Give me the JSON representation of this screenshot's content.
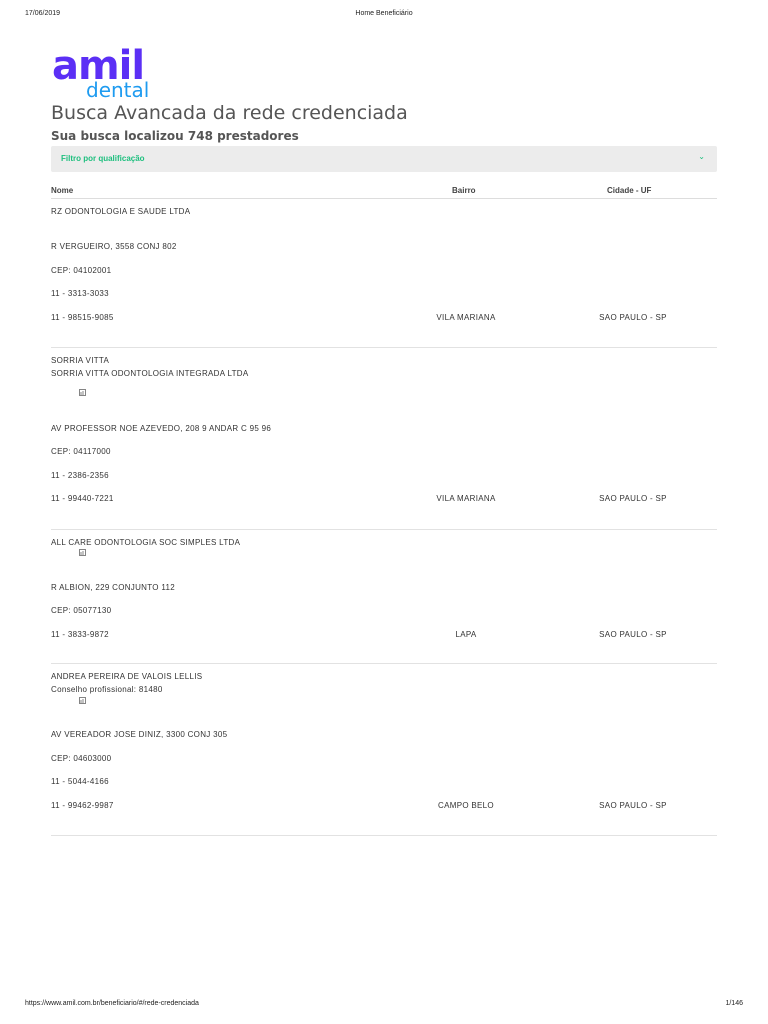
{
  "print": {
    "date": "17/06/2019",
    "title": "Home Beneficiário",
    "url": "https://www.amil.com.br/beneficiario/#/rede-credenciada",
    "pages": "1/146"
  },
  "logo": {
    "line1": "amil",
    "line2": "dental"
  },
  "page": {
    "title": "Busca Avancada da rede credenciada",
    "result_count": "Sua busca localizou 748 prestadores"
  },
  "filter": {
    "label": "Filtro por qualificação",
    "chevron": "⌄"
  },
  "table": {
    "headers": {
      "nome": "Nome",
      "bairro": "Bairro",
      "cidade": "Cidade - UF"
    }
  },
  "colors": {
    "brand_purple": "#5b2ff5",
    "brand_blue": "#1e9bf0",
    "accent_green": "#1dbf7e"
  },
  "providers": [
    {
      "name": "RZ ODONTOLOGIA E SAUDE LTDA",
      "address": "R VERGUEIRO, 3558 CONJ 802",
      "cep": "CEP: 04102001",
      "phone1": "11 - 3313-3033",
      "phone2": "11 - 98515-9085",
      "bairro": "VILA MARIANA",
      "cidade": "SAO PAULO - SP"
    },
    {
      "name": "SORRIA VITTA",
      "subname": "SORRIA VITTA ODONTOLOGIA INTEGRADA LTDA",
      "icon": "qualification-icon",
      "address": "AV PROFESSOR NOE AZEVEDO, 208 9 ANDAR C 95 96",
      "cep": "CEP: 04117000",
      "phone1": "11 - 2386-2356",
      "phone2": "11 - 99440-7221",
      "bairro": "VILA MARIANA",
      "cidade": "SAO PAULO - SP"
    },
    {
      "name": "ALL CARE ODONTOLOGIA SOC SIMPLES LTDA",
      "icon": "qualification-icon",
      "address": "R ALBION, 229 CONJUNTO 112",
      "cep": "CEP: 05077130",
      "phone1": "11 - 3833-9872",
      "bairro": "LAPA",
      "cidade": "SAO PAULO - SP"
    },
    {
      "name": "ANDREA PEREIRA DE VALOIS LELLIS",
      "council": "Conselho profissional: 81480",
      "icon": "qualification-icon",
      "address": "AV VEREADOR JOSE DINIZ, 3300 CONJ 305",
      "cep": "CEP: 04603000",
      "phone1": "11 - 5044-4166",
      "phone2": "11 - 99462-9987",
      "bairro": "CAMPO BELO",
      "cidade": "SAO PAULO - SP"
    }
  ]
}
